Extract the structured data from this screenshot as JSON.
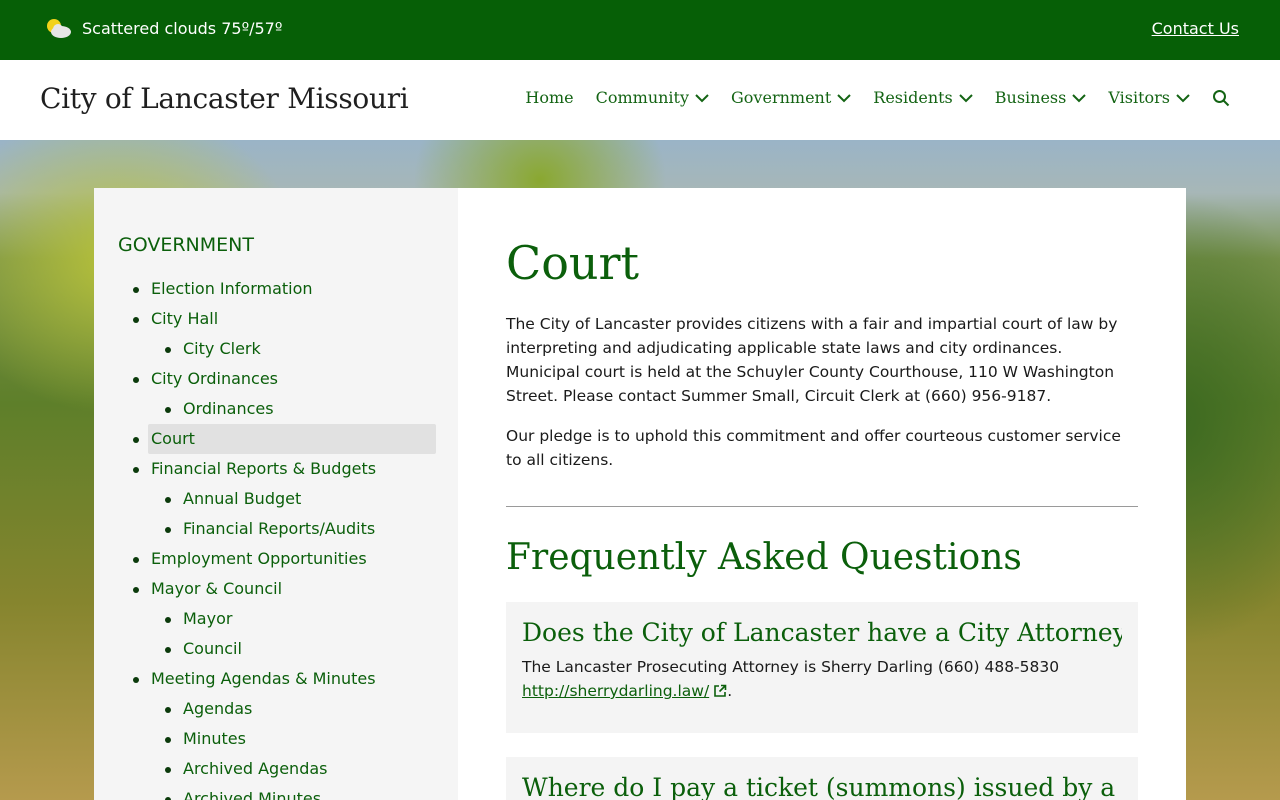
{
  "topbar": {
    "weather_icon": "partly-cloudy-icon",
    "weather_text": "Scattered clouds 75º/57º",
    "contact_label": "Contact Us"
  },
  "header": {
    "site_title": "City of Lancaster Missouri",
    "nav": [
      {
        "label": "Home",
        "dropdown": false
      },
      {
        "label": "Community",
        "dropdown": true
      },
      {
        "label": "Government",
        "dropdown": true
      },
      {
        "label": "Residents",
        "dropdown": true
      },
      {
        "label": "Business",
        "dropdown": true
      },
      {
        "label": "Visitors",
        "dropdown": true
      }
    ],
    "search_icon": "search-icon"
  },
  "sidebar": {
    "title": "GOVERNMENT",
    "items": [
      {
        "label": "Election Information",
        "level": 1
      },
      {
        "label": "City Hall",
        "level": 1
      },
      {
        "label": "City Clerk",
        "level": 2
      },
      {
        "label": "City Ordinances",
        "level": 1
      },
      {
        "label": "Ordinances",
        "level": 2
      },
      {
        "label": "Court",
        "level": 1,
        "active": true
      },
      {
        "label": "Financial Reports & Budgets",
        "level": 1
      },
      {
        "label": "Annual Budget",
        "level": 2
      },
      {
        "label": "Financial Reports/Audits",
        "level": 2
      },
      {
        "label": "Employment Opportunities",
        "level": 1
      },
      {
        "label": "Mayor & Council",
        "level": 1
      },
      {
        "label": "Mayor",
        "level": 2
      },
      {
        "label": "Council",
        "level": 2
      },
      {
        "label": "Meeting Agendas & Minutes",
        "level": 1
      },
      {
        "label": "Agendas",
        "level": 2
      },
      {
        "label": "Minutes",
        "level": 2
      },
      {
        "label": "Archived Agendas",
        "level": 2
      },
      {
        "label": "Archived Minutes",
        "level": 2
      }
    ]
  },
  "main": {
    "title": "Court",
    "paragraphs": [
      "The City of Lancaster provides citizens with a fair and impartial court of law by interpreting and adjudicating applicable state laws and city ordinances. Municipal court is held at the Schuyler County Courthouse, 110 W Washington Street. Please contact Summer Small, Circuit Clerk at (660) 956-9187.",
      "Our pledge is to uphold this commitment and offer courteous customer service to all citizens."
    ],
    "faq_heading": "Frequently Asked Questions",
    "faqs": [
      {
        "question": "Does the City of Lancaster have a City Attorney?",
        "answer_text": "The Lancaster Prosecuting Attorney is Sherry Darling (660) 488-5830",
        "link": "http://sherrydarling.law/",
        "link_icon": "external-link-icon",
        "after_link": "."
      },
      {
        "question": "Where do I pay a ticket (summons) issued by a"
      }
    ]
  },
  "colors": {
    "brand_green": "#065f06",
    "link_green": "#0b5f0b",
    "sidebar_bg": "#f5f5f5",
    "active_bg": "#e1e1e1"
  }
}
